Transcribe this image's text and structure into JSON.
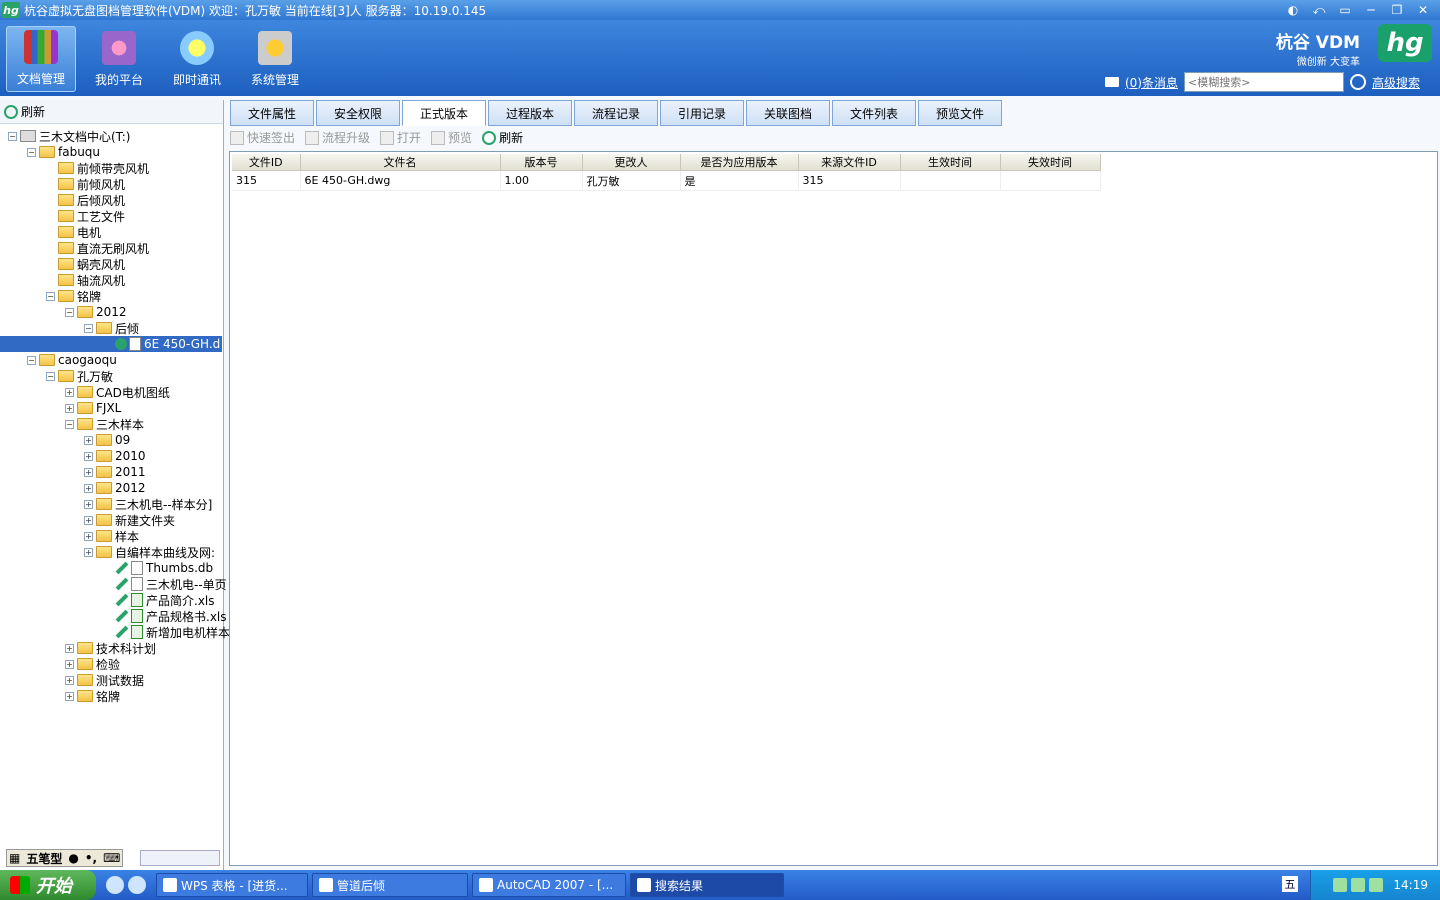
{
  "window": {
    "title": "杭谷虚拟无盘图档管理软件(VDM) 欢迎：孔万敏 当前在线[3]人 服务器：10.19.0.145"
  },
  "nav": [
    {
      "label": "文档管理",
      "icon": "books-icon"
    },
    {
      "label": "我的平台",
      "icon": "people-icon"
    },
    {
      "label": "即时通讯",
      "icon": "chat-icon"
    },
    {
      "label": "系统管理",
      "icon": "settings-icon"
    }
  ],
  "brand": {
    "name": "杭谷 VDM",
    "sub": "微创新 大变革",
    "logo": "hg"
  },
  "header": {
    "messages": "(0)条消息",
    "search_placeholder": "<模糊搜索>",
    "advanced": "高级搜索"
  },
  "left": {
    "refresh": "刷新"
  },
  "tree": [
    {
      "label": "三木文档中心(T:)",
      "level": 0,
      "exp": "-",
      "type": "drive"
    },
    {
      "label": "fabuqu",
      "level": 1,
      "exp": "-",
      "type": "folder"
    },
    {
      "label": "前倾带壳风机",
      "level": 2,
      "exp": "",
      "type": "folder"
    },
    {
      "label": "前倾风机",
      "level": 2,
      "exp": "",
      "type": "folder"
    },
    {
      "label": "后倾风机",
      "level": 2,
      "exp": "",
      "type": "folder"
    },
    {
      "label": "工艺文件",
      "level": 2,
      "exp": "",
      "type": "folder"
    },
    {
      "label": "电机",
      "level": 2,
      "exp": "",
      "type": "folder"
    },
    {
      "label": "直流无刷风机",
      "level": 2,
      "exp": "",
      "type": "folder"
    },
    {
      "label": "蜗壳风机",
      "level": 2,
      "exp": "",
      "type": "folder"
    },
    {
      "label": "轴流风机",
      "level": 2,
      "exp": "",
      "type": "folder"
    },
    {
      "label": "铭牌",
      "level": 2,
      "exp": "-",
      "type": "folder"
    },
    {
      "label": "2012",
      "level": 3,
      "exp": "-",
      "type": "folder"
    },
    {
      "label": "后倾",
      "level": 4,
      "exp": "-",
      "type": "folder"
    },
    {
      "label": "6E 450-GH.d",
      "level": 5,
      "exp": "",
      "type": "dwg",
      "selected": true
    },
    {
      "label": "caogaoqu",
      "level": 1,
      "exp": "-",
      "type": "folder"
    },
    {
      "label": "孔万敏",
      "level": 2,
      "exp": "-",
      "type": "folder"
    },
    {
      "label": "CAD电机图纸",
      "level": 3,
      "exp": "+",
      "type": "folder"
    },
    {
      "label": "FJXL",
      "level": 3,
      "exp": "+",
      "type": "folder"
    },
    {
      "label": "三木样本",
      "level": 3,
      "exp": "-",
      "type": "folder"
    },
    {
      "label": "09",
      "level": 4,
      "exp": "+",
      "type": "folder"
    },
    {
      "label": "2010",
      "level": 4,
      "exp": "+",
      "type": "folder"
    },
    {
      "label": "2011",
      "level": 4,
      "exp": "+",
      "type": "folder"
    },
    {
      "label": "2012",
      "level": 4,
      "exp": "+",
      "type": "folder"
    },
    {
      "label": "三木机电--样本分]",
      "level": 4,
      "exp": "+",
      "type": "folder"
    },
    {
      "label": "新建文件夹",
      "level": 4,
      "exp": "+",
      "type": "folder"
    },
    {
      "label": "样本",
      "level": 4,
      "exp": "+",
      "type": "folder"
    },
    {
      "label": "自编样本曲线及网:",
      "level": 4,
      "exp": "+",
      "type": "folder"
    },
    {
      "label": "Thumbs.db",
      "level": 5,
      "exp": "",
      "type": "file"
    },
    {
      "label": "三木机电--单页",
      "level": 5,
      "exp": "",
      "type": "file"
    },
    {
      "label": "产品简介.xls",
      "level": 5,
      "exp": "",
      "type": "xls"
    },
    {
      "label": "产品规格书.xls",
      "level": 5,
      "exp": "",
      "type": "xls"
    },
    {
      "label": "新增加电机样本",
      "level": 5,
      "exp": "",
      "type": "xls"
    },
    {
      "label": "技术科计划",
      "level": 3,
      "exp": "+",
      "type": "folder"
    },
    {
      "label": "检验",
      "level": 3,
      "exp": "+",
      "type": "folder"
    },
    {
      "label": "测试数据",
      "level": 3,
      "exp": "+",
      "type": "folder"
    },
    {
      "label": "铭牌",
      "level": 3,
      "exp": "+",
      "type": "folder"
    }
  ],
  "ime": {
    "label": "五笔型"
  },
  "tabs": [
    "文件属性",
    "安全权限",
    "正式版本",
    "过程版本",
    "流程记录",
    "引用记录",
    "关联图档",
    "文件列表",
    "预览文件"
  ],
  "active_tab": 2,
  "subtools": [
    {
      "label": "快速签出",
      "enabled": false
    },
    {
      "label": "流程升级",
      "enabled": false
    },
    {
      "label": "打开",
      "enabled": false
    },
    {
      "label": "预览",
      "enabled": false
    },
    {
      "label": "刷新",
      "enabled": true
    }
  ],
  "table": {
    "columns": [
      "文件ID",
      "文件名",
      "版本号",
      "更改人",
      "是否为应用版本",
      "来源文件ID",
      "生效时间",
      "失效时间"
    ],
    "rows": [
      [
        "315",
        "6E 450-GH.dwg",
        "1.00",
        "孔万敏",
        "是",
        "315",
        "",
        ""
      ]
    ]
  },
  "taskbar": {
    "start": "开始",
    "buttons": [
      {
        "label": "WPS 表格 - [进货..."
      },
      {
        "label": "管道后倾"
      },
      {
        "label": "AutoCAD 2007 - [..."
      },
      {
        "label": "搜索结果"
      }
    ],
    "clock": "14:19"
  }
}
